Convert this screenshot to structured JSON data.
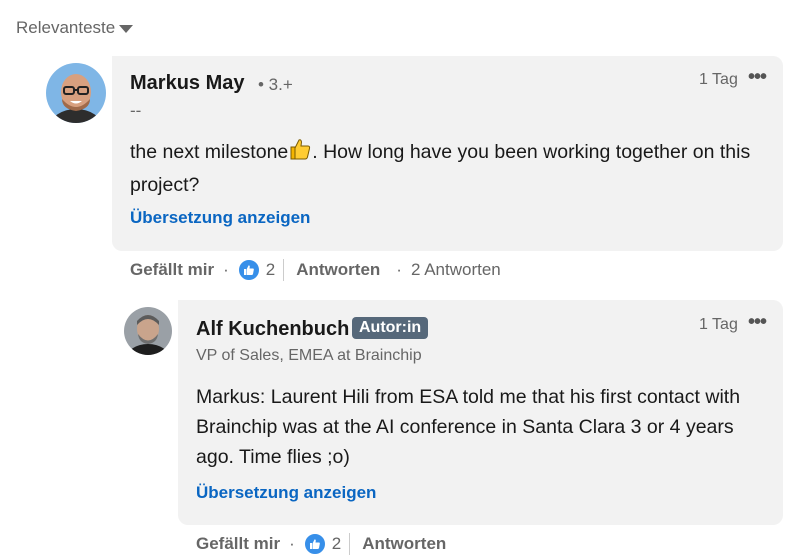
{
  "sort": {
    "label": "Relevanteste"
  },
  "comments": [
    {
      "author": "Markus May",
      "degree": "• 3.+",
      "subtitle": "--",
      "time": "1 Tag",
      "text_before": "the next milestone",
      "text_after": ". How long have you been working together on this project?",
      "translate_label": "Übersetzung anzeigen",
      "like_label": "Gefällt mir",
      "reaction_count": "2",
      "reply_label": "Antworten",
      "replies_label": "2 Antworten"
    },
    {
      "author": "Alf Kuchenbuch",
      "badge": "Autor:in",
      "subtitle": "VP of Sales, EMEA at Brainchip",
      "time": "1 Tag",
      "text": "Markus: Laurent Hili from ESA told me that his first contact with Brainchip was at the AI conference in Santa Clara 3 or 4 years ago. Time flies ;o)",
      "translate_label": "Übersetzung anzeigen",
      "like_label": "Gefällt mir",
      "reaction_count": "2",
      "reply_label": "Antworten"
    }
  ],
  "icons": {
    "sort": "caret-down-icon",
    "more": "more-dots-icon",
    "reaction": "thumbs-up-icon",
    "emoji": "thumbs-up-emoji"
  },
  "colors": {
    "accent": "#0a66c2",
    "bubble": "#f2f2f2",
    "badge": "#56687a",
    "reaction": "#378fe9"
  }
}
